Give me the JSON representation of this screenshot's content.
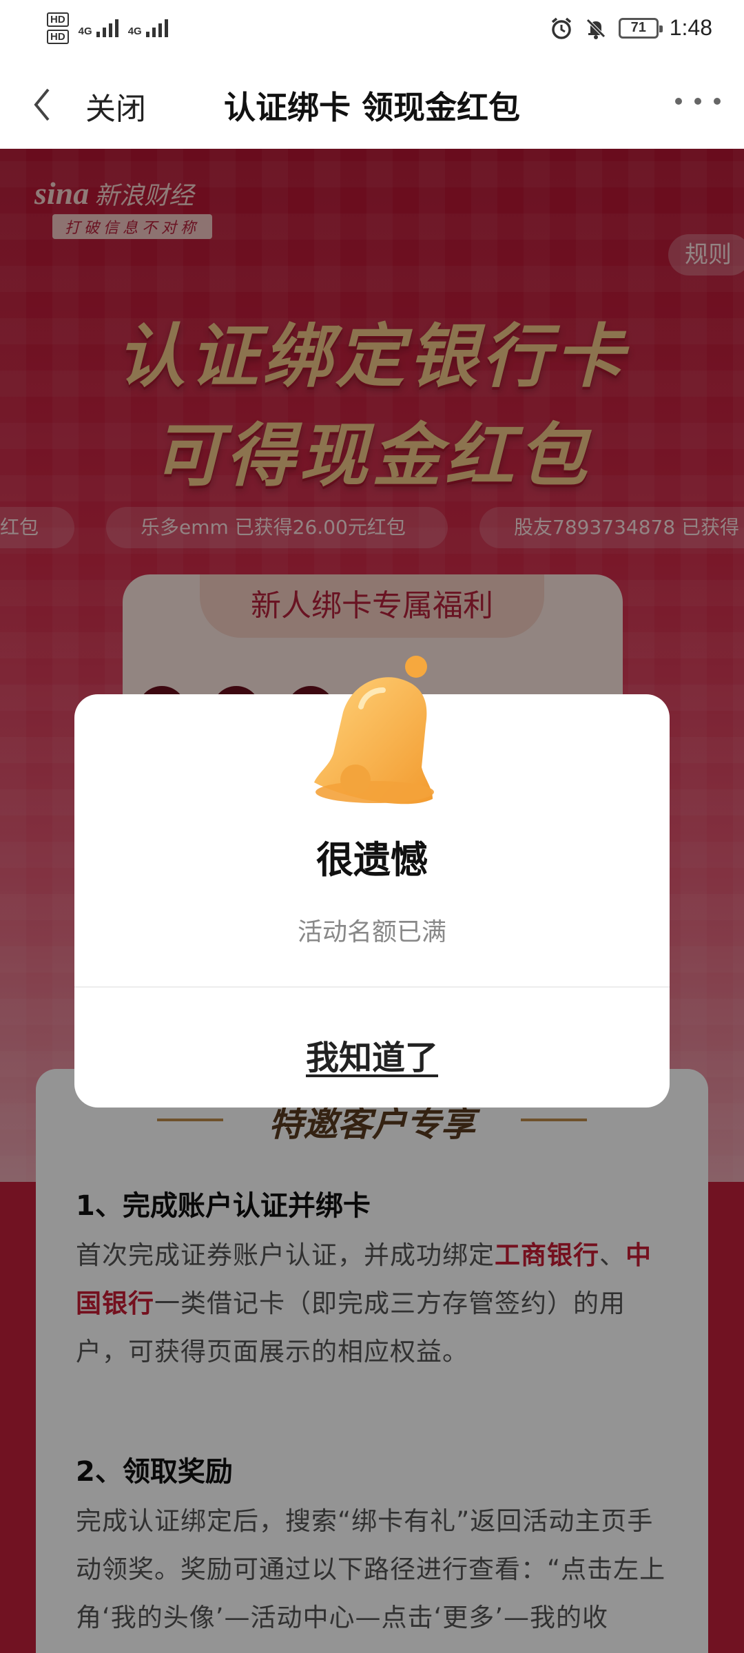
{
  "status_bar": {
    "hd1": "HD",
    "hd2": "HD",
    "net1": "4G",
    "net2": "4G",
    "battery": "71",
    "time": "1:48"
  },
  "nav": {
    "close": "关闭",
    "title": "认证绑卡 领现金红包"
  },
  "hero": {
    "logo_brand": "sina",
    "logo_name": "新浪财经",
    "logo_slogan": "打破信息不对称",
    "rules": "规则",
    "headline_1": "认证绑定银行卡",
    "headline_2": "可得现金红包",
    "ticker": [
      "红包",
      "乐多emm 已获得26.00元红包",
      "股友7893734878 已获得"
    ]
  },
  "benefit": {
    "tab": "新人绑卡专属福利"
  },
  "card": {
    "section_title": "特邀客户专享",
    "step1_title": "1、完成账户认证并绑卡",
    "step1_a": "首次完成证券账户认证，并成功绑定",
    "step1_bank1": "工商银行",
    "step1_sep": "、",
    "step1_bank2": "中国银行",
    "step1_b": "一类借记卡（即完成三方存管签约）的用户，可获得页面展示的相应权益。",
    "step2_title": "2、领取奖励",
    "step2_text": "完成认证绑定后，搜索“绑卡有礼”返回活动主页手动领奖。奖励可通过以下路径进行查看：“点击左上角‘我的头像’—活动中心—点击‘更多’—我的收"
  },
  "dialog": {
    "title": "很遗憾",
    "message": "活动名额已满",
    "confirm": "我知道了"
  },
  "colors": {
    "brand_red": "#c3203c",
    "gold_text": "#f2c988",
    "bell": "#f7b54a"
  }
}
